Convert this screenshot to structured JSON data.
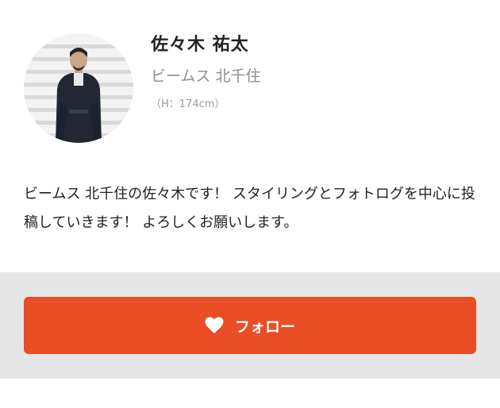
{
  "profile": {
    "name": "佐々木 祐太",
    "shop": "ビームス 北千住",
    "height": "（H：174cm）",
    "avatar_icon": "staff-avatar-photo"
  },
  "bio": {
    "text": "ビームス 北千住の佐々木です！ スタイリングとフォトログを中心に投稿していきます！ よろしくお願いします。"
  },
  "follow": {
    "label": "フォロー",
    "icon": "heart-icon",
    "button_color": "#e94e24",
    "area_color": "#e6e6e6"
  }
}
